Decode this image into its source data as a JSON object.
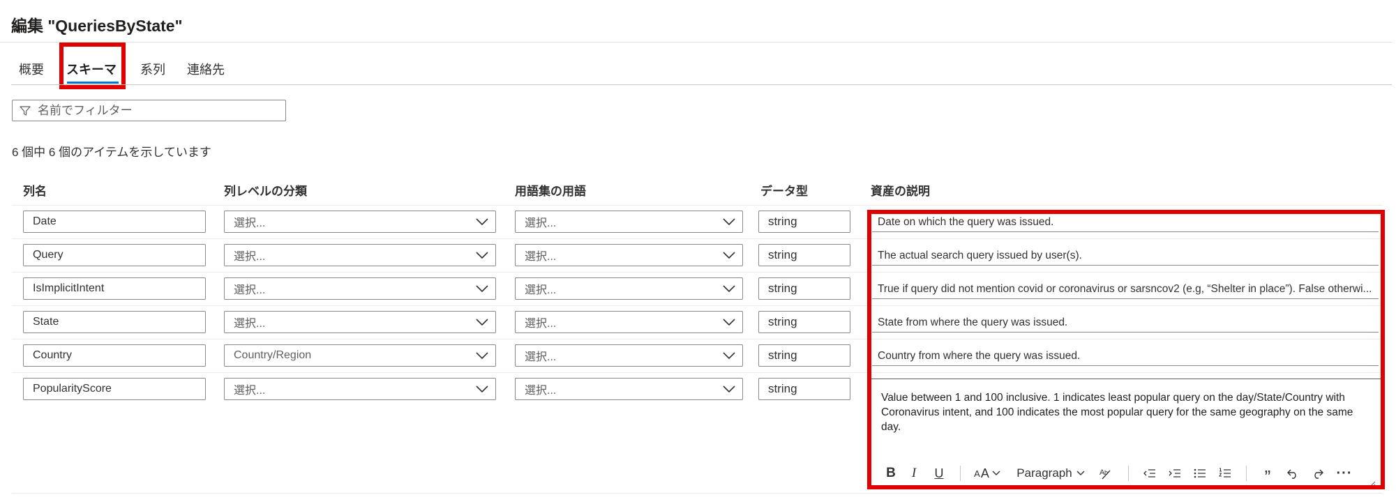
{
  "page": {
    "title": "編集 \"QueriesByState\""
  },
  "tabs": [
    {
      "label": "概要"
    },
    {
      "label": "スキーマ"
    },
    {
      "label": "系列"
    },
    {
      "label": "連絡先"
    }
  ],
  "filter": {
    "placeholder": "名前でフィルター",
    "icon": "filter-icon"
  },
  "item_count": "6 個中 6 個のアイテムを示しています",
  "columns": {
    "name": "列名",
    "classification": "列レベルの分類",
    "glossary": "用語集の用語",
    "data_type": "データ型",
    "description": "資産の説明"
  },
  "rows": [
    {
      "name": "Date",
      "classification": "選択...",
      "glossary": "選択...",
      "data_type": "string",
      "description": "Date on which the query was issued."
    },
    {
      "name": "Query",
      "classification": "選択...",
      "glossary": "選択...",
      "data_type": "string",
      "description": "The actual search query issued by user(s)."
    },
    {
      "name": "IsImplicitIntent",
      "classification": "選択...",
      "glossary": "選択...",
      "data_type": "string",
      "description": "True if query did not mention covid or coronavirus or sarsncov2 (e.g, “Shelter in place”). False otherwi..."
    },
    {
      "name": "State",
      "classification": "選択...",
      "glossary": "選択...",
      "data_type": "string",
      "description": "State from where the query was issued."
    },
    {
      "name": "Country",
      "classification": "Country/Region",
      "glossary": "選択...",
      "data_type": "string",
      "description": "Country from where the query was issued."
    },
    {
      "name": "PopularityScore",
      "classification": "選択...",
      "glossary": "選択...",
      "data_type": "string",
      "description": "Value between 1 and 100 inclusive. 1 indicates least popular query on the day/State/Country with Coronavirus intent, and 100 indicates the most popular query for the same geography on the same day."
    }
  ],
  "editor_toolbar": {
    "bold_icon": "B",
    "italic_icon": "I",
    "underline_icon": "U",
    "font_size_icon": "A",
    "paragraph_label": "Paragraph",
    "more_icon": "···"
  },
  "colors": {
    "highlight": "#e00000",
    "accent": "#0078d4"
  }
}
